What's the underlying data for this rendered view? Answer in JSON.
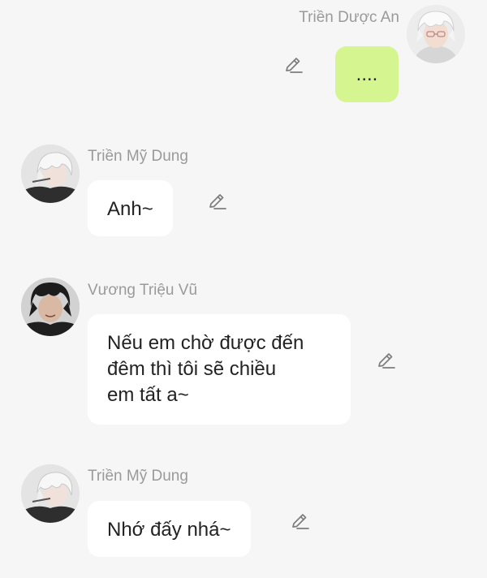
{
  "messages": [
    {
      "sender": "Triền Dược An",
      "text": "....",
      "direction": "outgoing",
      "avatar": "white-haired-glasses-avatar"
    },
    {
      "sender": "Triền Mỹ Dung",
      "text": "Anh~",
      "direction": "incoming",
      "avatar": "white-haired-avatar"
    },
    {
      "sender": "Vương Triệu Vũ",
      "text_lines": [
        "Nếu em chờ được đến",
        "đêm thì tôi sẽ chiều",
        "em tất a~"
      ],
      "direction": "incoming",
      "avatar": "dark-haired-avatar"
    },
    {
      "sender": "Triền Mỹ Dung",
      "text": "Nhớ đấy nhá~",
      "direction": "incoming",
      "avatar": "white-haired-avatar"
    }
  ],
  "icons": {
    "edit": "pencil-edit-icon"
  },
  "colors": {
    "background": "#f6f6f6",
    "outgoing_bubble": "#d4f590",
    "incoming_bubble": "#ffffff",
    "sender_name": "#9a9a9a",
    "message_text": "#222222"
  }
}
